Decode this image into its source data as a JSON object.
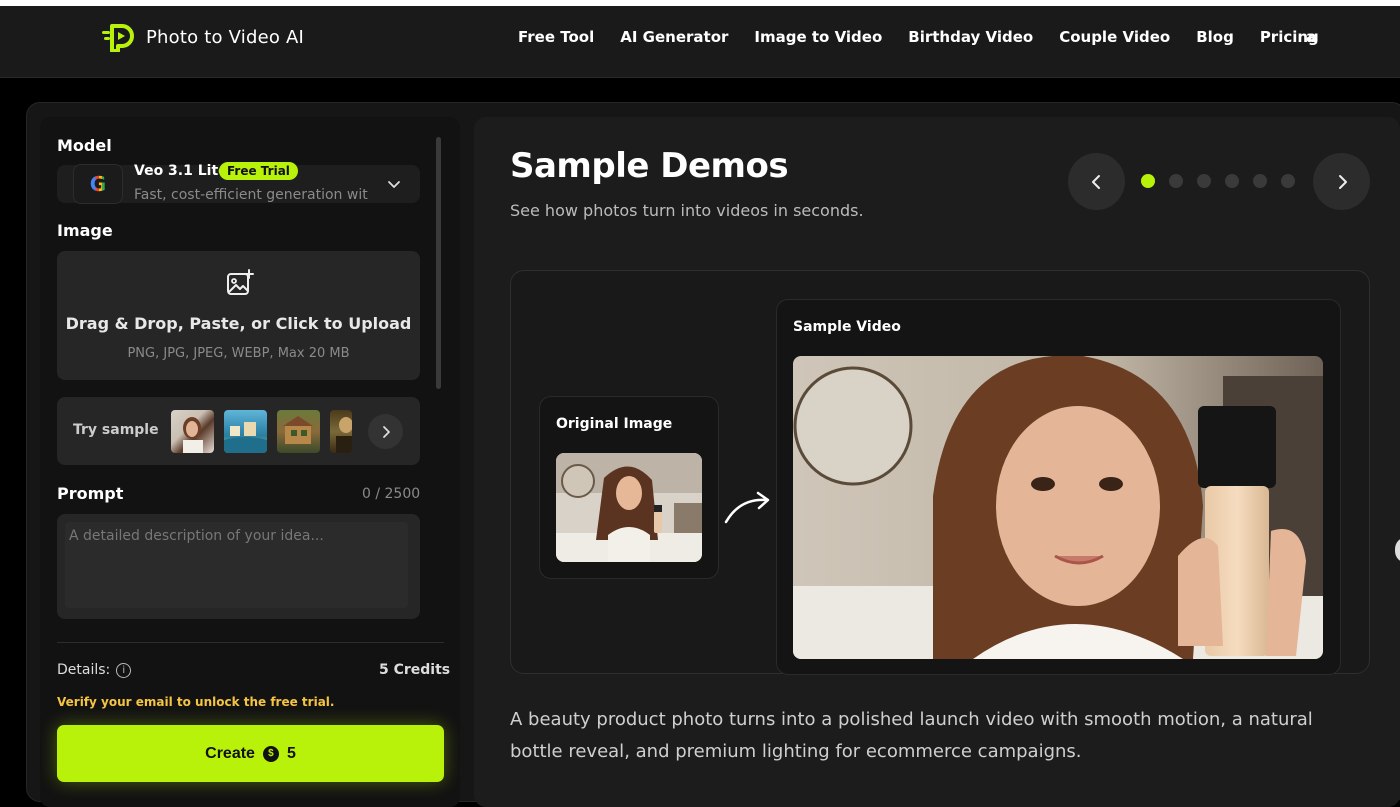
{
  "header": {
    "logo_text": "Photo to Video AI",
    "nav": [
      "Free Tool",
      "AI Generator",
      "Image to Video",
      "Birthday Video",
      "Couple Video",
      "Blog",
      "Pricing"
    ],
    "user_initial": "a"
  },
  "left_panel": {
    "model_label": "Model",
    "model": {
      "icon": "google-icon",
      "icon_glyph": "G",
      "name": "Veo 3.1 Lite",
      "badge": "Free Trial",
      "description": "Fast, cost-efficient generation wit"
    },
    "image_label": "Image",
    "upload": {
      "title": "Drag & Drop, Paste, or Click to Upload",
      "subtitle": "PNG, JPG, JPEG, WEBP, Max 20 MB"
    },
    "try_sample_label": "Try sample",
    "prompt_label": "Prompt",
    "prompt_count": "0 / 2500",
    "prompt_placeholder": "A detailed description of your idea...",
    "prompt_value": "",
    "details_label": "Details:",
    "credits": "5 Credits",
    "verify_notice": "Verify your email to unlock the free trial.",
    "create_label": "Create",
    "create_cost": "5",
    "coin_glyph": "$"
  },
  "right_panel": {
    "title": "Sample Demos",
    "subtitle": "See how photos turn into videos in seconds.",
    "carousel_total": 6,
    "carousel_active": 1,
    "original_label": "Original Image",
    "video_label": "Sample Video",
    "caption": "A beauty product photo turns into a polished launch video with smooth motion, a natural bottle reveal, and premium lighting for ecommerce campaigns."
  },
  "colors": {
    "accent": "#b8f20a",
    "warning": "#f5c542",
    "background": "#000000",
    "panel": "#1c1c1c"
  }
}
